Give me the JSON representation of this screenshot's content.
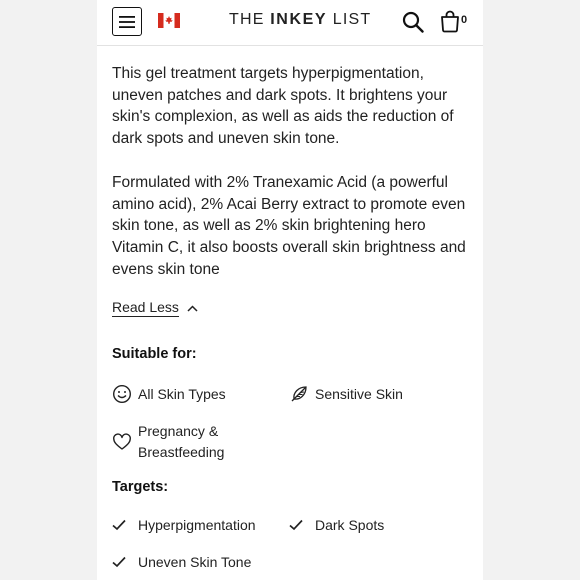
{
  "header": {
    "menu_icon": "hamburger-menu-icon",
    "flag_icon": "canada-flag-icon",
    "logo_light_1": "THE ",
    "logo_bold": "INKEY",
    "logo_light_2": " LIST",
    "search_icon": "search-icon",
    "bag_icon": "shopping-bag-icon",
    "bag_count": "0"
  },
  "description": {
    "paragraph_1": "This gel treatment targets hyperpigmentation, uneven patches and dark spots. It brightens your skin's complexion, as well as aids the reduction of dark spots and uneven skin tone.",
    "paragraph_2": "Formulated with 2% Tranexamic Acid (a powerful amino acid), 2% Acai Berry extract to promote even skin tone, as well as 2% skin brightening hero Vitamin C, it also boosts overall skin brightness and evens skin tone",
    "read_less_label": "Read Less"
  },
  "suitable_for": {
    "title": "Suitable for:",
    "items": [
      {
        "label": "All Skin Types",
        "icon": "smiley-face-icon"
      },
      {
        "label": "Sensitive Skin",
        "icon": "feather-icon"
      },
      {
        "label": "Pregnancy & Breastfeeding",
        "icon": "heart-icon"
      }
    ]
  },
  "targets": {
    "title": "Targets:",
    "items": [
      {
        "label": "Hyperpigmentation",
        "icon": "checkmark-icon"
      },
      {
        "label": "Dark Spots",
        "icon": "checkmark-icon"
      },
      {
        "label": "Uneven Skin Tone",
        "icon": "checkmark-icon"
      }
    ]
  },
  "colors": {
    "text": "#222222",
    "flag_red": "#d52b1e",
    "background": "#ffffff"
  }
}
